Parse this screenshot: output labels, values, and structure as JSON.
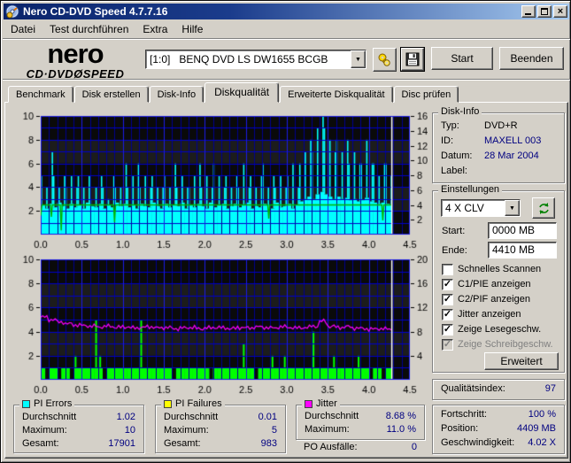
{
  "window": {
    "title": "Nero CD-DVD Speed 4.7.7.16"
  },
  "menu": {
    "items": [
      "Datei",
      "Test durchführen",
      "Extra",
      "Hilfe"
    ]
  },
  "header": {
    "logo_line1": "nero",
    "logo_line2": "CD·DVDØSPEED",
    "drive_select_value": "[1:0]   BENQ DVD LS DW1655 BCGB",
    "start_button": "Start",
    "quit_button": "Beenden"
  },
  "tabs": {
    "items": [
      "Benchmark",
      "Disk erstellen",
      "Disk-Info",
      "Diskqualität",
      "Erweiterte Diskqualität",
      "Disc prüfen"
    ],
    "active": "Diskqualität"
  },
  "disk_info": {
    "title": "Disk-Info",
    "typ_label": "Typ:",
    "typ_value": "DVD+R",
    "id_label": "ID:",
    "id_value": "MAXELL 003",
    "datum_label": "Datum:",
    "datum_value": "28 Mar 2004",
    "label_label": "Label:",
    "label_value": ""
  },
  "settings": {
    "title": "Einstellungen",
    "speed_select_value": "4 X CLV",
    "start_label": "Start:",
    "start_value": "0000 MB",
    "end_label": "Ende:",
    "end_value": "4410 MB",
    "checkboxes": [
      {
        "label": "Schnelles Scannen",
        "checked": false,
        "disabled": false
      },
      {
        "label": "C1/PIE anzeigen",
        "checked": true,
        "disabled": false
      },
      {
        "label": "C2/PIF anzeigen",
        "checked": true,
        "disabled": false
      },
      {
        "label": "Jitter anzeigen",
        "checked": true,
        "disabled": false
      },
      {
        "label": "Zeige Lesegeschw.",
        "checked": true,
        "disabled": false
      },
      {
        "label": "Zeige Schreibgeschw.",
        "checked": true,
        "disabled": true
      }
    ],
    "advanced_button": "Erweitert"
  },
  "quality": {
    "label": "Qualitätsindex:",
    "value": "97"
  },
  "progress": {
    "rows": [
      {
        "label": "Fortschritt:",
        "value": "100 %"
      },
      {
        "label": "Position:",
        "value": "4409 MB"
      },
      {
        "label": "Geschwindigkeit:",
        "value": "4.02 X"
      }
    ]
  },
  "stats": {
    "pi_errors": {
      "title": "PI Errors",
      "swatch": "#00FFFF",
      "rows": [
        {
          "label": "Durchschnitt",
          "value": "1.02"
        },
        {
          "label": "Maximum:",
          "value": "10"
        },
        {
          "label": "Gesamt:",
          "value": "17901"
        }
      ]
    },
    "pi_failures": {
      "title": "PI Failures",
      "swatch": "#FFFF00",
      "rows": [
        {
          "label": "Durchschnitt",
          "value": "0.01"
        },
        {
          "label": "Maximum:",
          "value": "5"
        },
        {
          "label": "Gesamt:",
          "value": "983"
        }
      ]
    },
    "jitter": {
      "title": "Jitter",
      "swatch": "#FF00FF",
      "rows": [
        {
          "label": "Durchschnitt",
          "value": "8.68 %"
        },
        {
          "label": "Maximum:",
          "value": "11.0 %"
        }
      ]
    },
    "po_failures": {
      "label": "PO Ausfälle:",
      "value": "0"
    }
  },
  "colors": {
    "dialog": "#D4D0C8",
    "navy": "#000080",
    "chart_bg": "#0A0A0A",
    "chart_band": "#1C1C1C",
    "grid_minor": "#000090",
    "grid_major": "#1A1AE6",
    "grid_h": "#0000C8",
    "pie": "#00FFFF",
    "pif": "#00FF00",
    "speed": "#00B400",
    "jitter": "#FF00FF",
    "cursor": "#FFFFFF",
    "axis_text": "#000000"
  },
  "chart_data": [
    {
      "type": "bar",
      "name": "pi-errors-scan",
      "x_range": [
        0,
        4.5
      ],
      "x_ticks": [
        0.0,
        0.5,
        1.0,
        1.5,
        2.0,
        2.5,
        3.0,
        3.5,
        4.0,
        4.5
      ],
      "x_tick_labels": [
        "0.0",
        "0.5",
        "1.0",
        "1.5",
        "2.0",
        "2.5",
        "3.0",
        "3.5",
        "4.0",
        "4.5"
      ],
      "left_axis": {
        "range": [
          0,
          10
        ],
        "ticks": [
          2,
          4,
          6,
          8,
          10
        ]
      },
      "right_axis": {
        "range": [
          0,
          16
        ],
        "ticks": [
          2,
          4,
          6,
          8,
          10,
          12,
          14,
          16
        ]
      },
      "sample_step": 0.05,
      "cursor_x": 4.28,
      "pie_spike_values": [
        5,
        4,
        7,
        5,
        4,
        5,
        4,
        5,
        4,
        5,
        4,
        5,
        3,
        4,
        5,
        4,
        3,
        5,
        4,
        4,
        6,
        4,
        5,
        6,
        4,
        5,
        4,
        5,
        4,
        4,
        5,
        4,
        6,
        4,
        5,
        4,
        4,
        5,
        6,
        4,
        5,
        4,
        6,
        5,
        4,
        5,
        4,
        5,
        4,
        6,
        4,
        5,
        4,
        5,
        6,
        4,
        5,
        4,
        5,
        4,
        5,
        6,
        4,
        6,
        7,
        8,
        7,
        9,
        10,
        9,
        8,
        7,
        8,
        7,
        8,
        6,
        7,
        6,
        6,
        8,
        6,
        6,
        5,
        6,
        6,
        5
      ],
      "pie_base_values": [
        2.5,
        2.2,
        2.6,
        2.3,
        2.7,
        2.4,
        2.2,
        2.6,
        2.3,
        2.5,
        2.2,
        2.7,
        2.4,
        2.3,
        2.6,
        2.2,
        2.5,
        2.3,
        2.7,
        2.4,
        2.6,
        2.3,
        2.5,
        2.2,
        2.6,
        2.4,
        2.3,
        2.7,
        2.4,
        2.2,
        2.6,
        2.3,
        2.5,
        2.4,
        2.7,
        2.2,
        2.5,
        2.3,
        2.6,
        2.4,
        2.2,
        2.7,
        2.3,
        2.5,
        2.6,
        2.2,
        2.4,
        2.6,
        2.3,
        2.5,
        2.7,
        2.2,
        2.4,
        2.3,
        2.6,
        2.5,
        2.2,
        2.7,
        2.3,
        2.4,
        2.6,
        2.2,
        2.5,
        2.8,
        3.0,
        3.2,
        3.0,
        3.4,
        3.6,
        3.4,
        3.2,
        3.0,
        3.2,
        3.0,
        3.1,
        2.9,
        3.0,
        2.8,
        2.9,
        3.1,
        2.8,
        2.7,
        2.6,
        2.7,
        2.6,
        2.5
      ],
      "speed_line_level_left_units": 2.5,
      "speed_dips": [
        [
          0.13,
          1.5
        ],
        [
          0.25,
          0.35
        ],
        [
          0.9,
          1.05
        ],
        [
          2.78,
          1.35
        ],
        [
          4.17,
          1.2
        ]
      ]
    },
    {
      "type": "bar+line",
      "name": "pi-failures-jitter-scan",
      "x_range": [
        0,
        4.5
      ],
      "x_ticks": [
        0.0,
        0.5,
        1.0,
        1.5,
        2.0,
        2.5,
        3.0,
        3.5,
        4.0,
        4.5
      ],
      "x_tick_labels": [
        "0.0",
        "0.5",
        "1.0",
        "1.5",
        "2.0",
        "2.5",
        "3.0",
        "3.5",
        "4.0",
        "4.5"
      ],
      "left_axis": {
        "range": [
          0,
          10
        ],
        "ticks": [
          2,
          4,
          6,
          8,
          10
        ]
      },
      "right_axis": {
        "range": [
          0,
          20
        ],
        "ticks": [
          4,
          8,
          12,
          16,
          20
        ]
      },
      "sample_step": 0.05,
      "cursor_x": 4.28,
      "pif_values": [
        1,
        0,
        1,
        1,
        0,
        1,
        1,
        0,
        2,
        1,
        1,
        1,
        1,
        5,
        2,
        0,
        1,
        1,
        1,
        1,
        1,
        1,
        1,
        1,
        5,
        1,
        1,
        1,
        1,
        1,
        1,
        1,
        0,
        1,
        1,
        1,
        1,
        1,
        1,
        1,
        1,
        0,
        1,
        1,
        1,
        1,
        1,
        1,
        1,
        3,
        1,
        1,
        0,
        1,
        1,
        1,
        2,
        1,
        1,
        2,
        1,
        1,
        1,
        1,
        1,
        1,
        4,
        1,
        1,
        1,
        1,
        2,
        1,
        1,
        1,
        1,
        1,
        2,
        1,
        1,
        0,
        1,
        1,
        0,
        1,
        1
      ],
      "jitter_step": 0.1,
      "jitter_percent": [
        10.4,
        10.0,
        9.6,
        9.3,
        9.1,
        9.0,
        8.9,
        8.8,
        8.9,
        8.7,
        8.8,
        8.6,
        8.7,
        8.8,
        8.6,
        8.7,
        8.5,
        8.6,
        8.7,
        8.5,
        8.6,
        8.7,
        8.6,
        8.5,
        8.7,
        8.6,
        8.8,
        8.7,
        8.6,
        8.8,
        8.7,
        8.6,
        8.7,
        8.9,
        9.7,
        8.9,
        8.7,
        8.8,
        8.6,
        8.5,
        8.4,
        8.5,
        8.4
      ]
    }
  ]
}
